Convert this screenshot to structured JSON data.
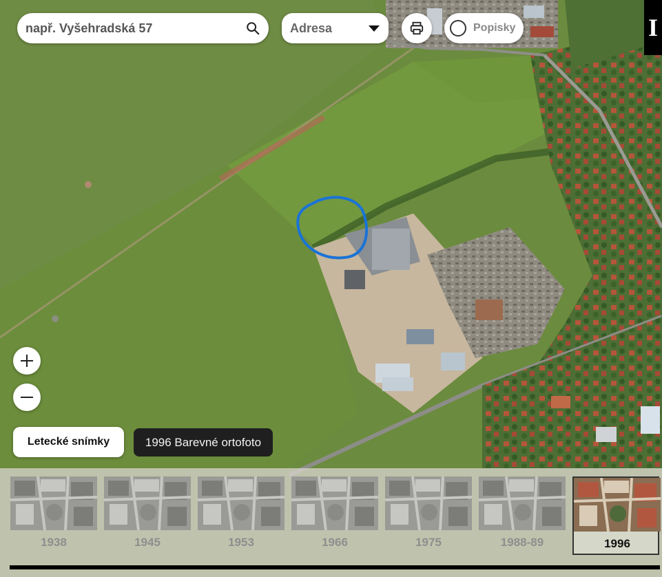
{
  "search": {
    "placeholder": "např. Vyšehradská 57",
    "icon": "search-icon"
  },
  "search_mode": {
    "selected": "Adresa",
    "icon": "caret-down-icon"
  },
  "print": {
    "icon": "printer-icon"
  },
  "labels_toggle": {
    "label": "Popisky",
    "checked": false
  },
  "info_button": {
    "label": "I"
  },
  "zoom": {
    "in_icon": "plus-icon",
    "out_icon": "minus-icon"
  },
  "layer": {
    "button_label": "Letecké snímky",
    "current_label": "1996 Barevné ortofoto"
  },
  "timeline": {
    "years": [
      "1938",
      "1945",
      "1953",
      "1966",
      "1975",
      "1988-89",
      "1996"
    ],
    "selected": "1996"
  },
  "colors": {
    "annotation": "#1a73d6",
    "panel_dark": "#1f1f1f"
  }
}
